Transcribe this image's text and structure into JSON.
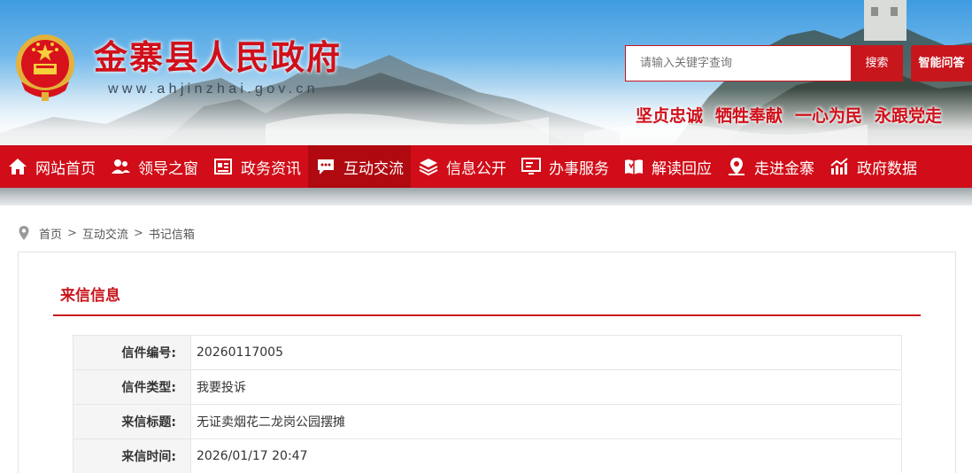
{
  "header": {
    "site_title": "金寨县人民政府",
    "site_url": "www.ahjinzhai.gov.cn",
    "search_placeholder": "请输入关键字查询",
    "search_button": "搜索",
    "ai_button": "智能问答",
    "slogans": [
      "坚贞忠诚",
      "牺牲奉献",
      "一心为民",
      "永跟党走"
    ]
  },
  "nav": {
    "items": [
      {
        "label": "网站首页",
        "icon": "home-icon"
      },
      {
        "label": "领导之窗",
        "icon": "people-icon"
      },
      {
        "label": "政务资讯",
        "icon": "news-icon"
      },
      {
        "label": "互动交流",
        "icon": "chat-icon",
        "active": true
      },
      {
        "label": "信息公开",
        "icon": "layers-icon"
      },
      {
        "label": "办事服务",
        "icon": "monitor-icon"
      },
      {
        "label": "解读回应",
        "icon": "book-icon"
      },
      {
        "label": "走进金寨",
        "icon": "location-icon"
      },
      {
        "label": "政府数据",
        "icon": "chart-icon"
      }
    ]
  },
  "breadcrumb": {
    "items": [
      "首页",
      "互动交流",
      "书记信箱"
    ],
    "separator": ">"
  },
  "content": {
    "section_title": "来信信息",
    "rows": [
      {
        "label": "信件编号:",
        "value": "20260117005"
      },
      {
        "label": "信件类型:",
        "value": "我要投诉"
      },
      {
        "label": "来信标题:",
        "value": "无证卖烟花二龙岗公园摆摊"
      },
      {
        "label": "来信时间:",
        "value": "2026/01/17 20:47"
      }
    ]
  },
  "colors": {
    "brand_red": "#d00d18",
    "title_red": "#c8161d"
  }
}
